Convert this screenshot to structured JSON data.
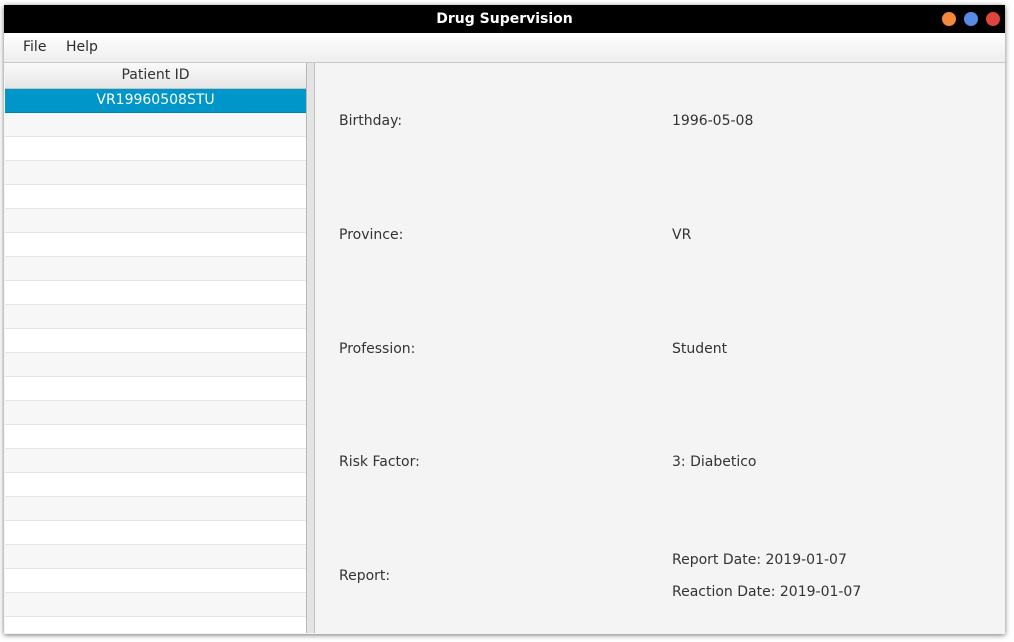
{
  "window": {
    "title": "Drug Supervision",
    "buttons": {
      "minimize_color": "#f5883a",
      "maximize_color": "#5a8ae6",
      "close_color": "#e0443e"
    }
  },
  "menu": {
    "file": "File",
    "help": "Help"
  },
  "patients": {
    "header": "Patient ID",
    "selected_id": "VR19960508STU"
  },
  "details": {
    "birthday_label": "Birthday:",
    "birthday_value": "1996-05-08",
    "province_label": "Province:",
    "province_value": "VR",
    "profession_label": "Profession:",
    "profession_value": "Student",
    "risk_label": "Risk Factor:",
    "risk_value": "3: Diabetico",
    "report_label": "Report:",
    "report_date": "Report Date: 2019-01-07",
    "reaction_date": "Reaction Date: 2019-01-07"
  },
  "colors": {
    "selection": "#0096c9",
    "titlebar": "#000000"
  }
}
